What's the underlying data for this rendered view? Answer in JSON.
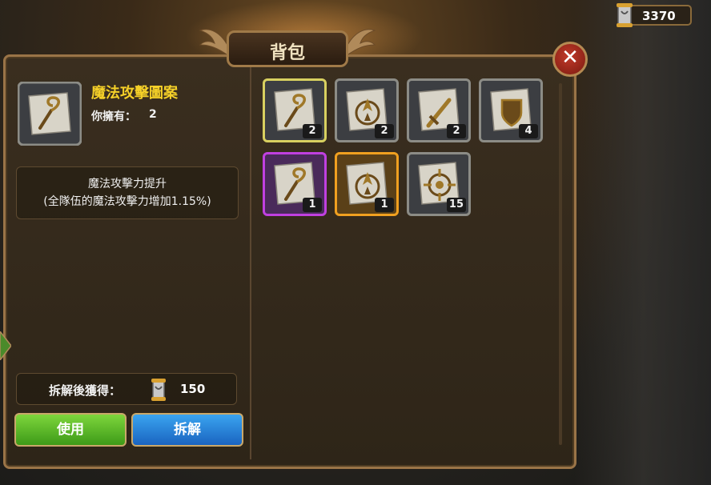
{
  "header": {
    "title": "背包",
    "currency_value": "3370"
  },
  "detail": {
    "item_name": "魔法攻擊圖案",
    "owned_label": "你擁有：",
    "owned_count": "2",
    "description_line1": "魔法攻擊力提升",
    "description_line2": "(全隊伍的魔法攻擊力增加1.15%)",
    "salvage_label": "拆解後獲得：",
    "salvage_value": "150"
  },
  "buttons": {
    "use_label": "使用",
    "salvage_label": "拆解"
  },
  "inventory": [
    {
      "icon": "staff-scroll-icon",
      "count": "2",
      "rarity": "white",
      "selected": true
    },
    {
      "icon": "flame-crest-scroll-icon",
      "count": "2",
      "rarity": "white",
      "selected": false
    },
    {
      "icon": "sword-scroll-icon",
      "count": "2",
      "rarity": "white",
      "selected": false
    },
    {
      "icon": "shield-scroll-icon",
      "count": "4",
      "rarity": "white",
      "selected": false
    },
    {
      "icon": "staff-scroll-icon",
      "count": "1",
      "rarity": "purple",
      "selected": false
    },
    {
      "icon": "flame-crest-scroll-icon",
      "count": "1",
      "rarity": "orange",
      "selected": false
    },
    {
      "icon": "crosshair-scroll-icon",
      "count": "15",
      "rarity": "white",
      "selected": false
    }
  ],
  "colors": {
    "item_name": "#f5d028",
    "use_button": "#5cb82a",
    "salvage_button": "#2a84d8",
    "rarity_purple": "#c040e0",
    "rarity_orange": "#f0a020"
  }
}
